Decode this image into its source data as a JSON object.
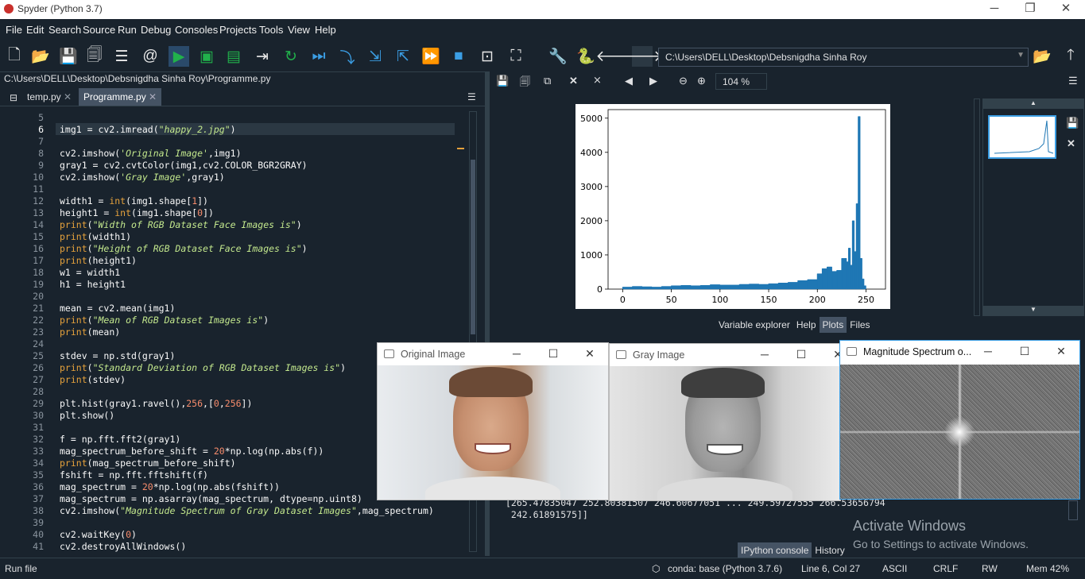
{
  "titlebar": {
    "title": "Spyder (Python 3.7)",
    "min": "─",
    "max": "❐",
    "close": "✕"
  },
  "menu": [
    "File",
    "Edit",
    "Search",
    "Source",
    "Run",
    "Debug",
    "Consoles",
    "Projects",
    "Tools",
    "View",
    "Help"
  ],
  "toolbar": {
    "path": "C:\\Users\\DELL\\Desktop\\Debsnigdha Sinha Roy"
  },
  "editor": {
    "filepath": "C:\\Users\\DELL\\Desktop\\Debsnigdha Sinha Roy\\Programme.py",
    "tabs": [
      {
        "label": "temp.py",
        "close": "✕"
      },
      {
        "label": "Programme.py",
        "close": "✕"
      }
    ],
    "cursor": "Line 6, Col 27",
    "lines": [
      {
        "n": "5",
        "code": ""
      },
      {
        "n": "6",
        "code": "img1 = cv2.imread(\"happy_2.jpg\")"
      },
      {
        "n": "7",
        "code": ""
      },
      {
        "n": "8",
        "code": "cv2.imshow('Original Image',img1)"
      },
      {
        "n": "9",
        "code": "gray1 = cv2.cvtColor(img1,cv2.COLOR_BGR2GRAY)"
      },
      {
        "n": "10",
        "code": "cv2.imshow('Gray Image',gray1)"
      },
      {
        "n": "11",
        "code": ""
      },
      {
        "n": "12",
        "code": "width1 = int(img1.shape[1])"
      },
      {
        "n": "13",
        "code": "height1 = int(img1.shape[0])"
      },
      {
        "n": "14",
        "code": "print(\"Width of RGB Dataset Face Images is\")"
      },
      {
        "n": "15",
        "code": "print(width1)"
      },
      {
        "n": "16",
        "code": "print(\"Height of RGB Dataset Face Images is\")"
      },
      {
        "n": "17",
        "code": "print(height1)"
      },
      {
        "n": "18",
        "code": "w1 = width1"
      },
      {
        "n": "19",
        "code": "h1 = height1"
      },
      {
        "n": "20",
        "code": ""
      },
      {
        "n": "21",
        "code": "mean = cv2.mean(img1)"
      },
      {
        "n": "22",
        "code": "print(\"Mean of RGB Dataset Images is\")"
      },
      {
        "n": "23",
        "code": "print(mean)"
      },
      {
        "n": "24",
        "code": ""
      },
      {
        "n": "25",
        "code": "stdev = np.std(gray1)"
      },
      {
        "n": "26",
        "code": "print(\"Standard Deviation of RGB Dataset Images is\")"
      },
      {
        "n": "27",
        "code": "print(stdev)"
      },
      {
        "n": "28",
        "code": ""
      },
      {
        "n": "29",
        "code": "plt.hist(gray1.ravel(),256,[0,256])"
      },
      {
        "n": "30",
        "code": "plt.show()"
      },
      {
        "n": "31",
        "code": ""
      },
      {
        "n": "32",
        "code": "f = np.fft.fft2(gray1)"
      },
      {
        "n": "33",
        "code": "mag_spectrum_before_shift = 20*np.log(np.abs(f))"
      },
      {
        "n": "34",
        "code": "print(mag_spectrum_before_shift)"
      },
      {
        "n": "35",
        "code": "fshift = np.fft.fftshift(f)"
      },
      {
        "n": "36",
        "code": "mag_spectrum = 20*np.log(np.abs(fshift))"
      },
      {
        "n": "37",
        "code": "mag_spectrum = np.asarray(mag_spectrum, dtype=np.uint8)"
      },
      {
        "n": "38",
        "code": "cv2.imshow(\"Magnitude Spectrum of Gray Dataset Images\",mag_spectrum)"
      },
      {
        "n": "39",
        "code": ""
      },
      {
        "n": "40",
        "code": "cv2.waitKey(0)"
      },
      {
        "n": "41",
        "code": "cv2.destroyAllWindows()"
      }
    ]
  },
  "plots": {
    "zoom": "104 %",
    "tabs": [
      "Variable explorer",
      "Help",
      "Plots",
      "Files"
    ],
    "active_tab": "Plots"
  },
  "chart_data": {
    "type": "bar",
    "title": "",
    "xlabel": "",
    "ylabel": "",
    "xlim": [
      -15,
      270
    ],
    "ylim": [
      0,
      5250
    ],
    "xticks": [
      0,
      50,
      100,
      150,
      200,
      250
    ],
    "yticks": [
      0,
      1000,
      2000,
      3000,
      4000,
      5000
    ],
    "color": "#1f77b4",
    "note_bins": "256 bins over [0,256]",
    "x": [
      0,
      10,
      20,
      30,
      40,
      50,
      60,
      70,
      80,
      90,
      100,
      110,
      120,
      130,
      140,
      150,
      160,
      170,
      180,
      190,
      200,
      205,
      210,
      215,
      220,
      225,
      230,
      232,
      234,
      236,
      238,
      240,
      242,
      244,
      246,
      248
    ],
    "values": [
      60,
      80,
      70,
      60,
      80,
      100,
      110,
      100,
      110,
      130,
      120,
      120,
      140,
      150,
      140,
      160,
      180,
      200,
      250,
      280,
      450,
      600,
      650,
      520,
      550,
      900,
      800,
      1200,
      700,
      2000,
      1100,
      2500,
      5050,
      900,
      300,
      100
    ]
  },
  "console": {
    "lines": [
      "[265.47835047 252.80381507 246.60677051 ... 249.59727555 266.53656794",
      " 242.61891575]]"
    ],
    "tabs": [
      "IPython console",
      "History"
    ],
    "active_tab": "IPython console"
  },
  "windows": {
    "original": {
      "title": "Original Image"
    },
    "gray": {
      "title": "Gray Image"
    },
    "magnitude": {
      "title": "Magnitude Spectrum o..."
    }
  },
  "activate": {
    "line1": "Activate Windows",
    "line2": "Go to Settings to activate Windows."
  },
  "status": {
    "left": "Run file",
    "conda": "conda: base (Python 3.7.6)",
    "cursor": "Line 6, Col 27",
    "encoding": "ASCII",
    "eol": "CRLF",
    "rw": "RW",
    "mem": "Mem 42%"
  }
}
